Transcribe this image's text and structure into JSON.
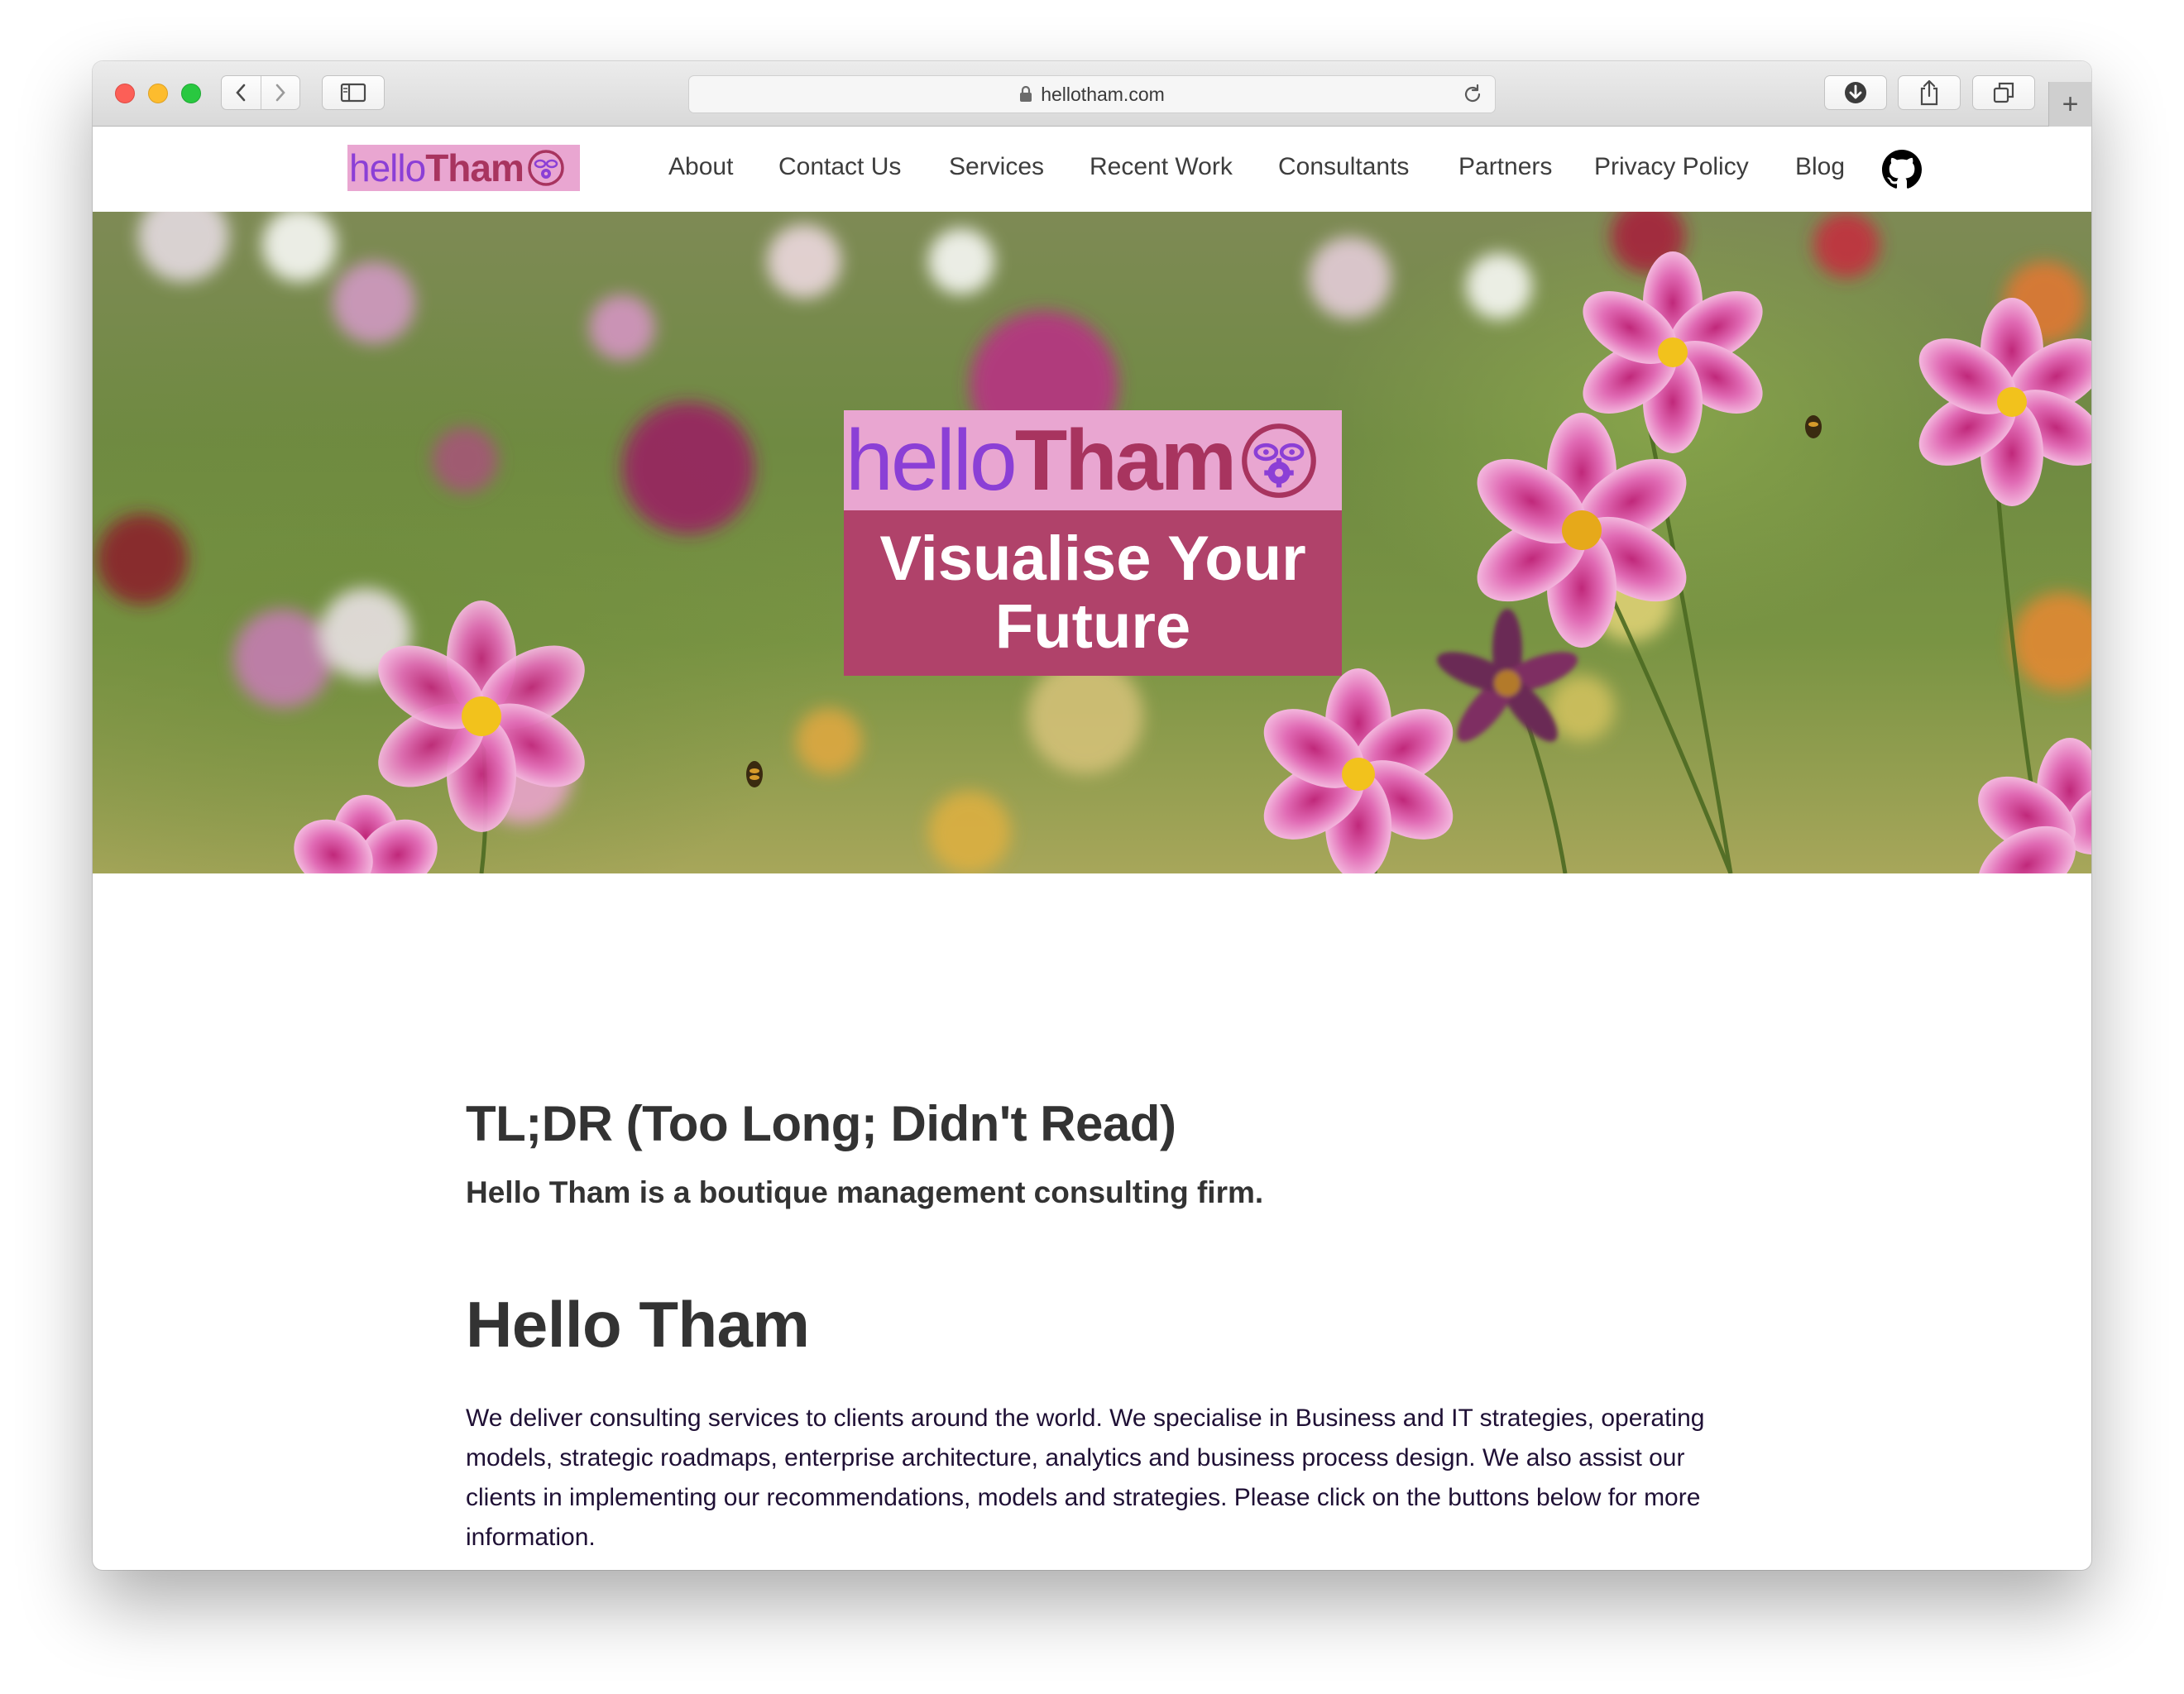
{
  "browser": {
    "url": "hellotham.com",
    "new_tab_label": "+"
  },
  "site": {
    "logo": {
      "hello": "hello",
      "tham": "Tham"
    },
    "nav": [
      {
        "label": "About"
      },
      {
        "label": "Contact Us"
      },
      {
        "label": "Services"
      },
      {
        "label": "Recent Work"
      },
      {
        "label": "Consultants"
      },
      {
        "label": "Partners"
      },
      {
        "label": "Privacy Policy"
      },
      {
        "label": "Blog"
      }
    ],
    "github_icon": "github-icon"
  },
  "hero": {
    "logo": {
      "hello": "hello",
      "tham": "Tham"
    },
    "tagline_line1": "Visualise Your",
    "tagline_line2": "Future"
  },
  "content": {
    "tldr_heading": "TL;DR (Too Long; Didn't Read)",
    "tldr_sub": "Hello Tham is a boutique management consulting firm.",
    "main_heading": "Hello Tham",
    "body": "We deliver consulting services to clients around the world. We specialise in Business and IT strategies, operating models, strategic roadmaps, enterprise architecture, analytics and business process design. We also assist our clients in implementing our recommendations, models and strategies. Please click on the buttons below for more information."
  },
  "colors": {
    "logo_bg": "#e9a6d1",
    "logo_hello": "#8b3fd6",
    "logo_tham": "#a8345f",
    "tagline_bg": "#b0426a",
    "text_dark": "#333333"
  }
}
